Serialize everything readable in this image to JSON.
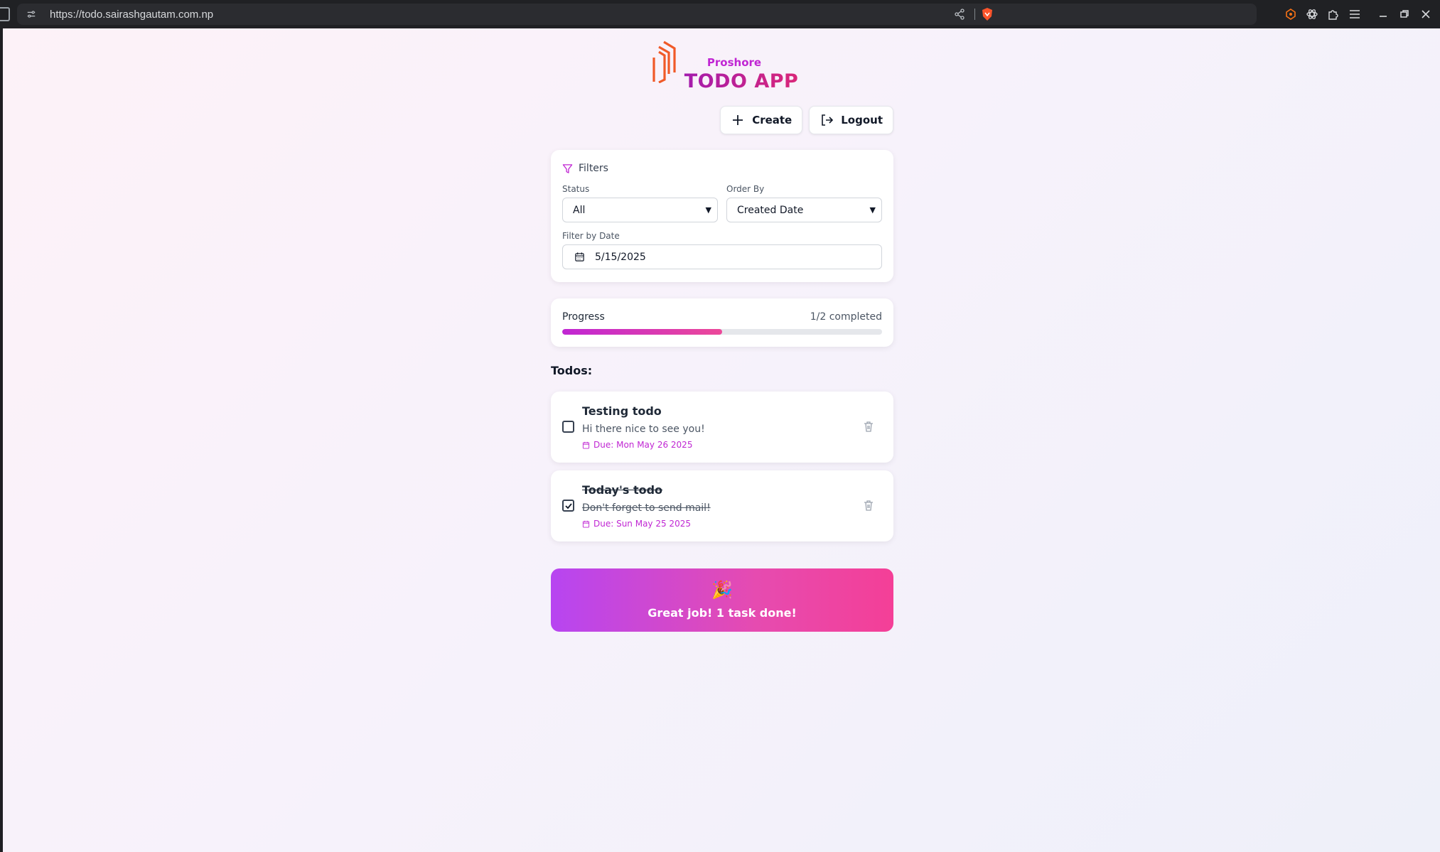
{
  "browser": {
    "url": "https://todo.sairashgautam.com.np"
  },
  "brand": {
    "subtitle": "Proshore",
    "title": "TODO APP"
  },
  "actions": {
    "create_label": "Create",
    "logout_label": "Logout"
  },
  "filters": {
    "heading": "Filters",
    "status_label": "Status",
    "status_value": "All",
    "order_label": "Order By",
    "order_value": "Created Date",
    "date_label": "Filter by Date",
    "date_value": "5/15/2025"
  },
  "progress": {
    "label": "Progress",
    "count_text": "1/2 completed",
    "completed": 1,
    "total": 2
  },
  "todos": {
    "heading": "Todos:",
    "items": [
      {
        "title": "Testing todo",
        "description": "Hi there nice to see you!",
        "due": "Due: Mon May 26 2025",
        "completed": false
      },
      {
        "title": "Today's todo",
        "description": "Don't forget to send mail!",
        "due": "Due: Sun May 25 2025",
        "completed": true
      }
    ]
  },
  "banner": {
    "emoji": "🎉",
    "message": "Great job! 1 task done!"
  },
  "colors": {
    "accent": "#c026d3",
    "accent_pink": "#ec4899"
  }
}
